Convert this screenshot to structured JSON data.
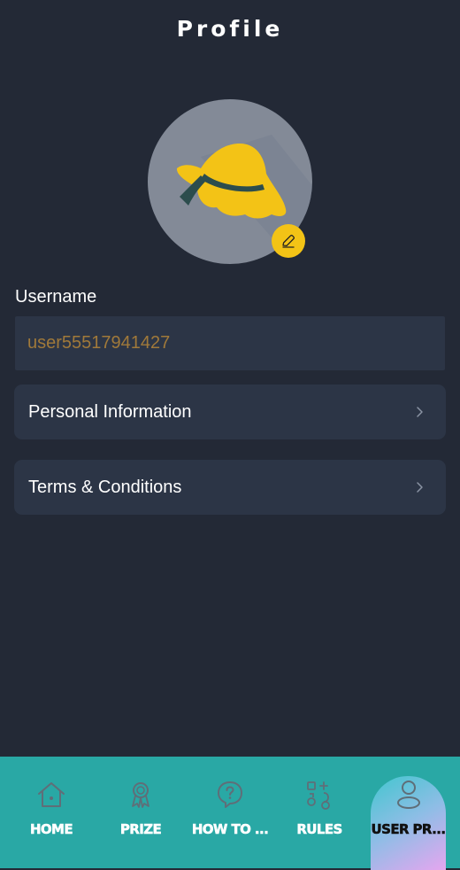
{
  "header": {
    "title": "Profile"
  },
  "avatar": {
    "icon": "sun-hat-icon",
    "edit_icon": "pencil-icon",
    "colors": {
      "background": "#838a97",
      "hat": "#f3c316",
      "ribbon": "#2c4d4d",
      "edit_button": "#f3c316"
    }
  },
  "username": {
    "label": "Username",
    "value": "user55517941427"
  },
  "menu": {
    "items": [
      {
        "label": "Personal Information",
        "icon": "chevron-right-icon"
      },
      {
        "label": "Terms & Conditions",
        "icon": "chevron-right-icon"
      }
    ]
  },
  "nav": {
    "background": "#29a8a5",
    "items": [
      {
        "label": "HOME",
        "icon": "home-icon"
      },
      {
        "label": "PRIZE",
        "icon": "award-icon"
      },
      {
        "label": "HOW TO ...",
        "icon": "question-chat-icon"
      },
      {
        "label": "RULES",
        "icon": "rules-icon"
      },
      {
        "label": "USER PR...",
        "icon": "user-icon",
        "active": true
      }
    ]
  },
  "theme": {
    "background": "#232936",
    "card": "#2c3546",
    "accent": "#f3c316",
    "username_text": "#a0793a"
  }
}
